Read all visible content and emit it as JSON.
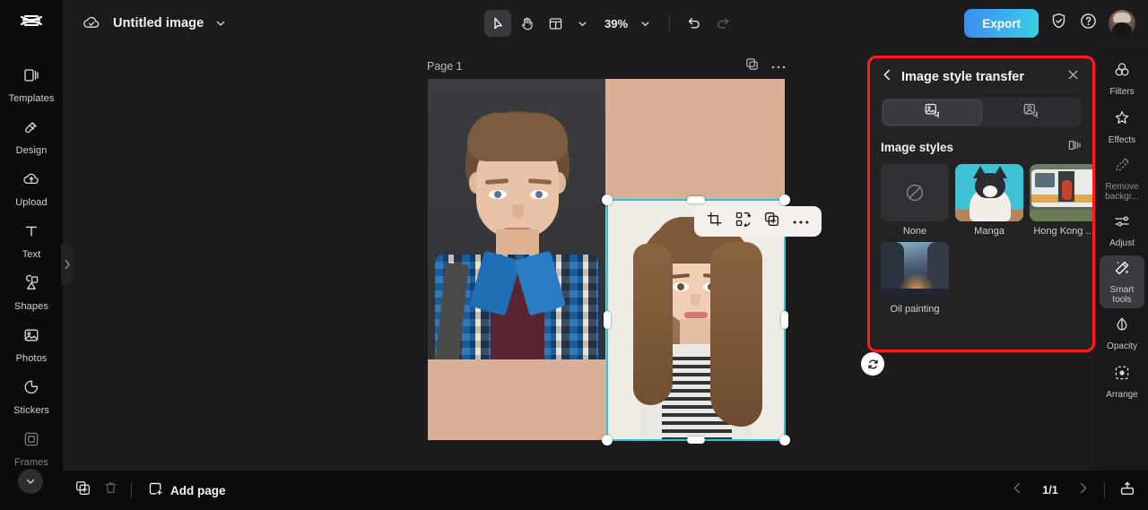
{
  "app": {
    "logo": "capcut-logo",
    "document_title": "Untitled image",
    "cloud_status_icon": "cloud-saved-icon",
    "title_caret_icon": "chevron-down-icon"
  },
  "toolbar": {
    "select_tool": "cursor-tool",
    "hand_tool": "hand-tool",
    "layout_tool": "layout-tool",
    "layout_caret": "chevron-down-icon",
    "zoom_level": "39%",
    "zoom_caret": "chevron-down-icon",
    "undo": "undo-icon",
    "redo": "redo-icon",
    "export_label": "Export",
    "shield_icon": "shield-check-icon",
    "help_icon": "help-circle-icon",
    "avatar": "user-avatar"
  },
  "sidebar": {
    "items": [
      {
        "label": "Templates",
        "icon": "templates-icon",
        "active": false
      },
      {
        "label": "Design",
        "icon": "design-icon",
        "active": false
      },
      {
        "label": "Upload",
        "icon": "upload-icon",
        "active": false
      },
      {
        "label": "Text",
        "icon": "text-icon",
        "active": false
      },
      {
        "label": "Shapes",
        "icon": "shapes-icon",
        "active": false
      },
      {
        "label": "Photos",
        "icon": "photos-icon",
        "active": false
      },
      {
        "label": "Stickers",
        "icon": "stickers-icon",
        "active": false
      },
      {
        "label": "Frames",
        "icon": "frames-icon",
        "active": false
      }
    ],
    "expand_icon": "chevron-down-icon",
    "panel_toggle_icon": "chevron-right-icon"
  },
  "canvas": {
    "page_label": "Page 1",
    "duplicate_page_icon": "duplicate-icon",
    "page_more_icon": "more-horizontal-icon",
    "background_color": "#d9b096",
    "context_toolbar": [
      {
        "icon": "crop-icon"
      },
      {
        "icon": "replace-image-icon"
      },
      {
        "icon": "duplicate-icon"
      },
      {
        "icon": "more-horizontal-icon"
      }
    ],
    "rotate_icon": "rotate-icon",
    "selection_color": "#2ec5d8"
  },
  "panel": {
    "back_icon": "chevron-left-icon",
    "title": "Image style transfer",
    "close_icon": "close-icon",
    "tabs": [
      {
        "icon": "image-style-icon",
        "active": true
      },
      {
        "icon": "portrait-style-icon",
        "active": false
      }
    ],
    "section_title": "Image styles",
    "compare_icon": "compare-split-icon",
    "styles": [
      {
        "name": "None",
        "thumb": "none",
        "selected": false
      },
      {
        "name": "Manga",
        "thumb": "manga",
        "selected": true
      },
      {
        "name": "Hong Kong ...",
        "thumb": "hongkong",
        "selected": false
      },
      {
        "name": "Oil painting",
        "thumb": "oil",
        "selected": false
      }
    ],
    "highlight_color": "#ff1b1b"
  },
  "right_rail": {
    "items": [
      {
        "label": "Filters",
        "icon": "filters-icon",
        "active": false
      },
      {
        "label": "Effects",
        "icon": "effects-icon",
        "active": false
      },
      {
        "label": "Remove\nbackgr...",
        "icon": "remove-background-icon",
        "active": false
      },
      {
        "label": "Adjust",
        "icon": "adjust-icon",
        "active": false
      },
      {
        "label": "Smart\ntools",
        "icon": "smart-tools-icon",
        "active": true
      },
      {
        "label": "Opacity",
        "icon": "opacity-icon",
        "active": false
      },
      {
        "label": "Arrange",
        "icon": "arrange-icon",
        "active": false
      }
    ]
  },
  "bottombar": {
    "duplicate_icon": "duplicate-icon",
    "delete_icon": "trash-icon",
    "add_page_label": "Add page",
    "add_page_icon": "add-page-icon",
    "prev_icon": "chevron-left-icon",
    "next_icon": "chevron-right-icon",
    "page_counter": "1/1",
    "present_icon": "present-icon"
  }
}
